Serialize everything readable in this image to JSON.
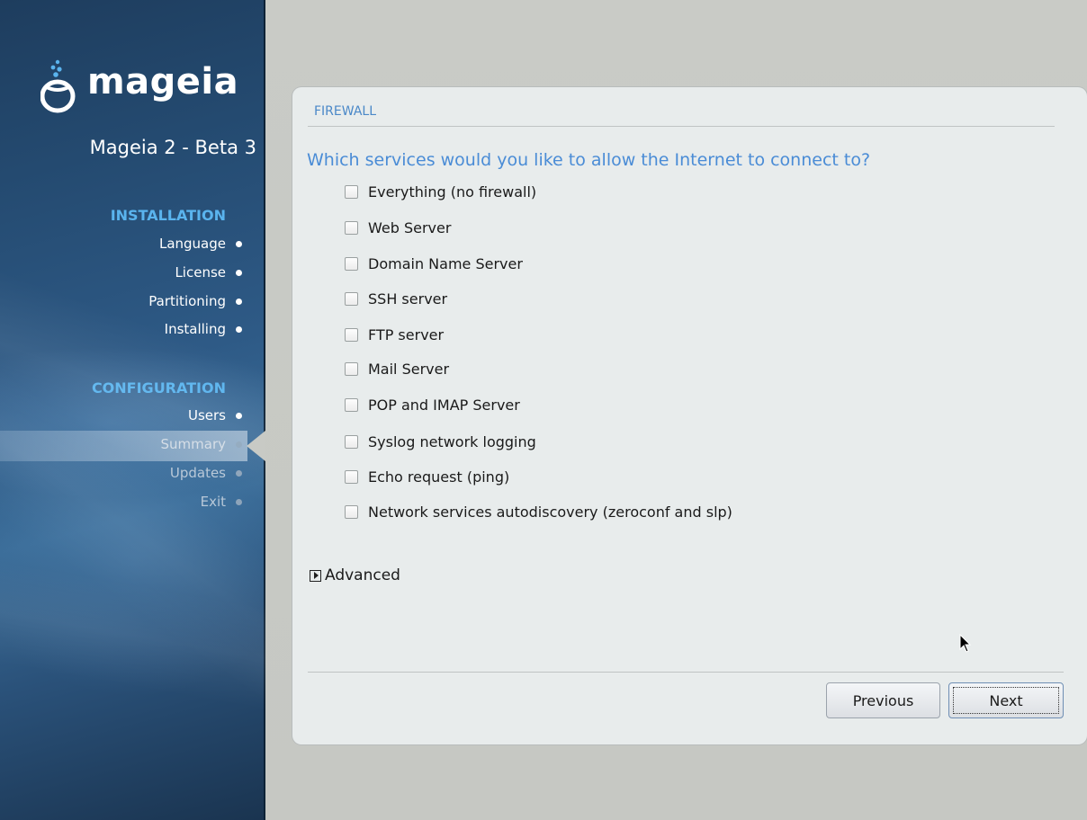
{
  "app": {
    "logo_text": "mageia",
    "version": "Mageia 2 - Beta 3"
  },
  "sidebar": {
    "installation": {
      "title": "INSTALLATION",
      "steps": [
        {
          "label": "Language",
          "state": "done"
        },
        {
          "label": "License",
          "state": "done"
        },
        {
          "label": "Partitioning",
          "state": "done"
        },
        {
          "label": "Installing",
          "state": "done"
        }
      ]
    },
    "configuration": {
      "title": "CONFIGURATION",
      "steps": [
        {
          "label": "Users",
          "state": "done"
        },
        {
          "label": "Summary",
          "state": "current"
        },
        {
          "label": "Updates",
          "state": "pending"
        },
        {
          "label": "Exit",
          "state": "pending"
        }
      ]
    }
  },
  "panel": {
    "title": "FIREWALL",
    "question": "Which services would you like to allow the Internet to connect to?",
    "options": [
      {
        "label": "Everything (no firewall)",
        "checked": false
      },
      {
        "label": "Web Server",
        "checked": false
      },
      {
        "label": "Domain Name Server",
        "checked": false
      },
      {
        "label": "SSH server",
        "checked": false
      },
      {
        "label": "FTP server",
        "checked": false
      },
      {
        "label": "Mail Server",
        "checked": false
      },
      {
        "label": "POP and IMAP Server",
        "checked": false
      },
      {
        "label": "Syslog network logging",
        "checked": false
      },
      {
        "label": "Echo request (ping)",
        "checked": false
      },
      {
        "label": "Network services autodiscovery (zeroconf and slp)",
        "checked": false
      }
    ],
    "advanced_label": "Advanced",
    "buttons": {
      "previous": "Previous",
      "next": "Next"
    }
  },
  "colors": {
    "accent": "#4a8cd6",
    "section_title": "#5ab4ee",
    "sidebar_bg": "#2e5a86"
  },
  "icons": {
    "logo": "mageia-cauldron-icon",
    "expander": "triangle-right-icon",
    "cursor": "arrow-cursor-icon"
  }
}
